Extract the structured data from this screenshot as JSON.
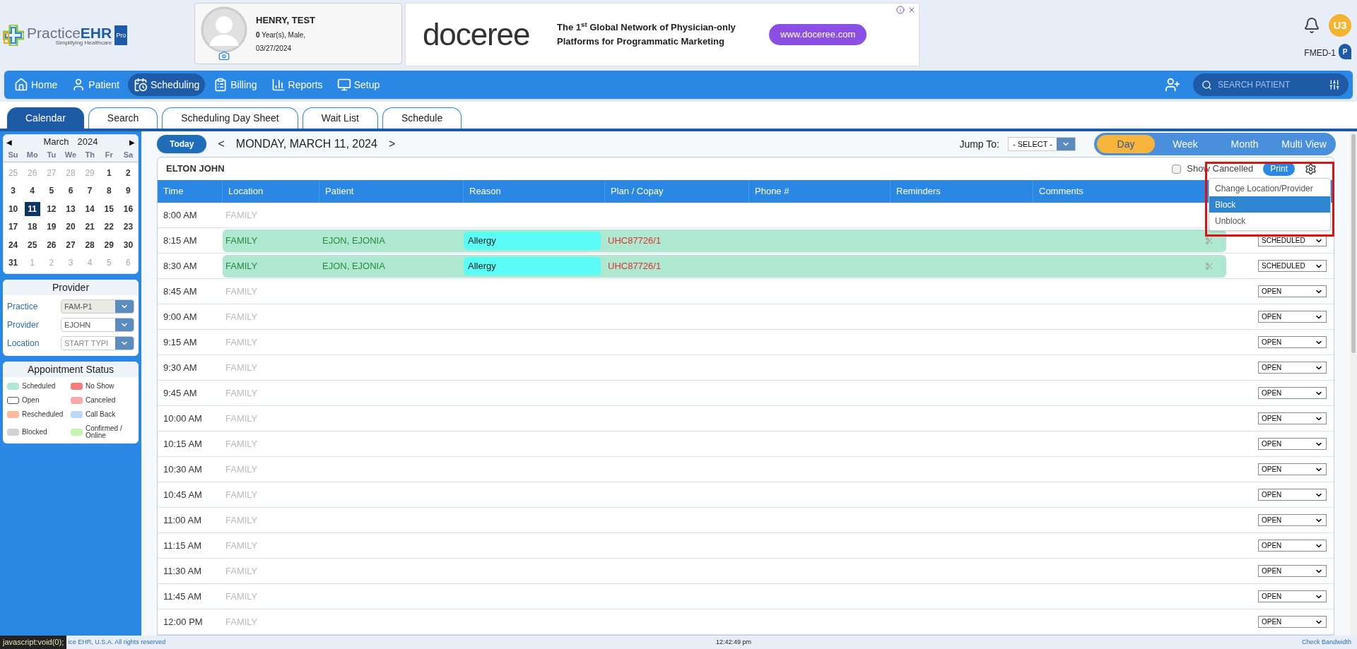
{
  "logo": {
    "name_light": "Practice",
    "name_bold": "EHR",
    "tagline": "Simplifying Healthcare",
    "edition": "Pro"
  },
  "patient": {
    "name": "HENRY, TEST",
    "age_sex": "**0** Year(s), Male,",
    "dob": "03/27/2024"
  },
  "ad": {
    "brand": "doceree",
    "headline": "The 1$^{st}$ Global Network of Physician-only Platforms for Programmatic Marketing",
    "button": "www.doceree.com"
  },
  "user": {
    "initials": "U3",
    "facility": "FMED-1",
    "pin_label": "P"
  },
  "nav": {
    "items": [
      {
        "label": "Home",
        "selected": false
      },
      {
        "label": "Patient",
        "selected": false
      },
      {
        "label": "Scheduling",
        "selected": true
      },
      {
        "label": "Billing",
        "selected": false
      },
      {
        "label": "Reports",
        "selected": false
      },
      {
        "label": "Setup",
        "selected": false
      }
    ],
    "search_placeholder": "SEARCH PATIENT"
  },
  "tabs": [
    {
      "label": "Calendar",
      "selected": true
    },
    {
      "label": "Search",
      "selected": false
    },
    {
      "label": "Scheduling Day Sheet",
      "selected": false
    },
    {
      "label": "Wait List",
      "selected": false
    },
    {
      "label": "Schedule",
      "selected": false
    }
  ],
  "calendar": {
    "prev": "◀",
    "next": "▶",
    "month": "March",
    "year": "2024",
    "weekdays": [
      "Su",
      "Mo",
      "Tu",
      "We",
      "Th",
      "Fr",
      "Sa"
    ],
    "weeks": [
      [
        {
          "day": "25",
          "in_month": false,
          "selected": false
        },
        {
          "day": "26",
          "in_month": false,
          "selected": false
        },
        {
          "day": "27",
          "in_month": false,
          "selected": false
        },
        {
          "day": "28",
          "in_month": false,
          "selected": false
        },
        {
          "day": "29",
          "in_month": false,
          "selected": false
        },
        {
          "day": "1",
          "in_month": true,
          "selected": false
        },
        {
          "day": "2",
          "in_month": true,
          "selected": false
        }
      ],
      [
        {
          "day": "3",
          "in_month": true,
          "selected": false
        },
        {
          "day": "4",
          "in_month": true,
          "selected": false
        },
        {
          "day": "5",
          "in_month": true,
          "selected": false
        },
        {
          "day": "6",
          "in_month": true,
          "selected": false
        },
        {
          "day": "7",
          "in_month": true,
          "selected": false
        },
        {
          "day": "8",
          "in_month": true,
          "selected": false
        },
        {
          "day": "9",
          "in_month": true,
          "selected": false
        }
      ],
      [
        {
          "day": "10",
          "in_month": true,
          "selected": false
        },
        {
          "day": "11",
          "in_month": true,
          "selected": true
        },
        {
          "day": "12",
          "in_month": true,
          "selected": false
        },
        {
          "day": "13",
          "in_month": true,
          "selected": false
        },
        {
          "day": "14",
          "in_month": true,
          "selected": false
        },
        {
          "day": "15",
          "in_month": true,
          "selected": false
        },
        {
          "day": "16",
          "in_month": true,
          "selected": false
        }
      ],
      [
        {
          "day": "17",
          "in_month": true,
          "selected": false
        },
        {
          "day": "18",
          "in_month": true,
          "selected": false
        },
        {
          "day": "19",
          "in_month": true,
          "selected": false
        },
        {
          "day": "20",
          "in_month": true,
          "selected": false
        },
        {
          "day": "21",
          "in_month": true,
          "selected": false
        },
        {
          "day": "22",
          "in_month": true,
          "selected": false
        },
        {
          "day": "23",
          "in_month": true,
          "selected": false
        }
      ],
      [
        {
          "day": "24",
          "in_month": true,
          "selected": false
        },
        {
          "day": "25",
          "in_month": true,
          "selected": false
        },
        {
          "day": "26",
          "in_month": true,
          "selected": false
        },
        {
          "day": "27",
          "in_month": true,
          "selected": false
        },
        {
          "day": "28",
          "in_month": true,
          "selected": false
        },
        {
          "day": "29",
          "in_month": true,
          "selected": false
        },
        {
          "day": "30",
          "in_month": true,
          "selected": false
        }
      ],
      [
        {
          "day": "31",
          "in_month": true,
          "selected": false
        },
        {
          "day": "1",
          "in_month": false,
          "selected": false
        },
        {
          "day": "2",
          "in_month": false,
          "selected": false
        },
        {
          "day": "3",
          "in_month": false,
          "selected": false
        },
        {
          "day": "4",
          "in_month": false,
          "selected": false
        },
        {
          "day": "5",
          "in_month": false,
          "selected": false
        },
        {
          "day": "6",
          "in_month": false,
          "selected": false
        }
      ]
    ]
  },
  "provider_panel": {
    "title": "Provider",
    "fields": [
      {
        "label": "Practice",
        "value": "FAM-P1",
        "disabled": true
      },
      {
        "label": "Provider",
        "value": "EJOHN",
        "disabled": false
      },
      {
        "label": "Location",
        "placeholder": "START TYPI",
        "disabled": false
      }
    ]
  },
  "status_legend": {
    "title": "Appointment Status",
    "items": [
      {
        "label": "Scheduled",
        "color": "#aee8d0"
      },
      {
        "label": "No Show",
        "color": "#f47c7c"
      },
      {
        "label": "Open",
        "color": "#ffffff"
      },
      {
        "label": "Canceled",
        "color": "#f8aaaa"
      },
      {
        "label": "Rescheduled",
        "color": "#fdbb9a"
      },
      {
        "label": "Call Back",
        "color": "#bcd8f5"
      },
      {
        "label": "Blocked",
        "color": "#d2d2d2"
      },
      {
        "label": "Confirmed / Online",
        "color": "#c4f5b0"
      }
    ]
  },
  "schedule": {
    "today_button": "Today",
    "prev": "<",
    "date": "MONDAY, MARCH 11, 2024",
    "next": ">",
    "jump_label": "Jump To:",
    "jump_value": "- SELECT -",
    "views": [
      {
        "label": "Day",
        "selected": true
      },
      {
        "label": "Week",
        "selected": false
      },
      {
        "label": "Month",
        "selected": false
      },
      {
        "label": "Multi View",
        "selected": false
      }
    ],
    "provider": "ELTON JOHN",
    "show_cancelled": {
      "label": "Show Cancelled",
      "checked": false
    },
    "print": "Print",
    "menu": [
      {
        "label": "Change Location/Provider",
        "selected": false
      },
      {
        "label": "Block",
        "selected": true
      },
      {
        "label": "Unblock",
        "selected": false
      }
    ],
    "columns": [
      "Time",
      "Location",
      "Patient",
      "Reason",
      "Plan / Copay",
      "Phone #",
      "Reminders",
      "Comments"
    ],
    "rows": [
      {
        "kind": "open",
        "time": "8:00 AM",
        "location": "FAMILY"
      },
      {
        "kind": "booked",
        "time": "8:15 AM",
        "location": "FAMILY",
        "patient": "EJON, EJONIA",
        "reason": "Allergy",
        "plan": "UHC87726/1",
        "status": "SCHEDULED"
      },
      {
        "kind": "booked",
        "time": "8:30 AM",
        "location": "FAMILY",
        "patient": "EJON, EJONIA",
        "reason": "Allergy",
        "plan": "UHC87726/1",
        "status": "SCHEDULED"
      },
      {
        "kind": "open",
        "time": "8:45 AM",
        "location": "FAMILY",
        "status": "OPEN"
      },
      {
        "kind": "open",
        "time": "9:00 AM",
        "location": "FAMILY",
        "status": "OPEN"
      },
      {
        "kind": "open",
        "time": "9:15 AM",
        "location": "FAMILY",
        "status": "OPEN"
      },
      {
        "kind": "open",
        "time": "9:30 AM",
        "location": "FAMILY",
        "status": "OPEN"
      },
      {
        "kind": "open",
        "time": "9:45 AM",
        "location": "FAMILY",
        "status": "OPEN"
      },
      {
        "kind": "open",
        "time": "10:00 AM",
        "location": "FAMILY",
        "status": "OPEN"
      },
      {
        "kind": "open",
        "time": "10:15 AM",
        "location": "FAMILY",
        "status": "OPEN"
      },
      {
        "kind": "open",
        "time": "10:30 AM",
        "location": "FAMILY",
        "status": "OPEN"
      },
      {
        "kind": "open",
        "time": "10:45 AM",
        "location": "FAMILY",
        "status": "OPEN"
      },
      {
        "kind": "open",
        "time": "11:00 AM",
        "location": "FAMILY",
        "status": "OPEN"
      },
      {
        "kind": "open",
        "time": "11:15 AM",
        "location": "FAMILY",
        "status": "OPEN"
      },
      {
        "kind": "open",
        "time": "11:30 AM",
        "location": "FAMILY",
        "status": "OPEN"
      },
      {
        "kind": "open",
        "time": "11:45 AM",
        "location": "FAMILY",
        "status": "OPEN"
      },
      {
        "kind": "open",
        "time": "12:00 PM",
        "location": "FAMILY",
        "status": "OPEN"
      }
    ]
  },
  "footer": {
    "link_preview": "javascript:void(0);",
    "copyright": "ice EHR, U.S.A. All rights reserved",
    "time": "12:42:49 pm",
    "bandwidth": "Check Bandwidth"
  }
}
